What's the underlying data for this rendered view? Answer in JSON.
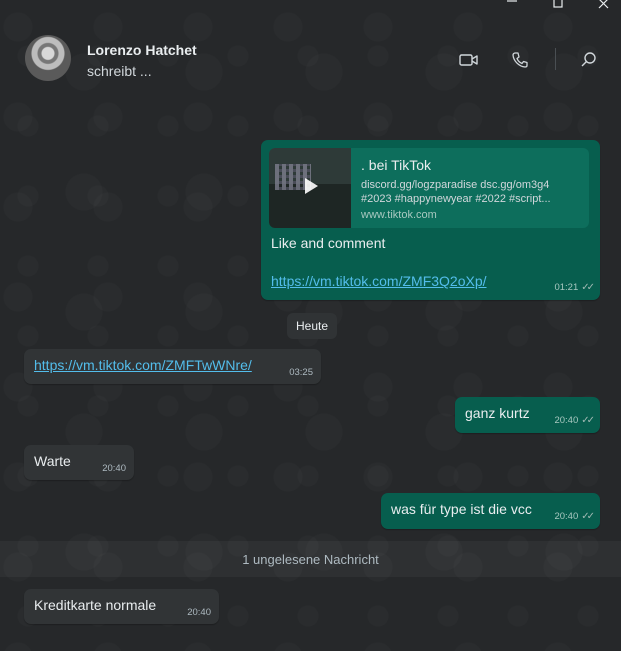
{
  "window": {
    "minimize": "—",
    "maximize": "▢",
    "close": "✕"
  },
  "contact": {
    "name": "Lorenzo Hatchet",
    "status": "schreibt ..."
  },
  "header_icons": [
    "video-call-icon",
    "voice-call-icon",
    "search-icon"
  ],
  "messages": {
    "tiktok_share": {
      "preview_title": ". bei TikTok",
      "preview_desc": "discord.gg/logzparadise dsc.gg/om3g4 #2023 #happynewyear #2022 #script...",
      "preview_url": "www.tiktok.com",
      "text": "Like and comment",
      "link": "https://vm.tiktok.com/ZMF3Q2oXp/",
      "time": "01:21"
    },
    "day_separator": "Heute",
    "incoming_link": {
      "link": "https://vm.tiktok.com/ZMFTwWNre/",
      "time": "03:25"
    },
    "ganz_kurtz": {
      "text": "ganz kurtz",
      "time": "20:40"
    },
    "warte": {
      "text": "Warte",
      "time": "20:40"
    },
    "vcc_question": {
      "text": "was für type ist die vcc",
      "time": "20:40"
    },
    "unread_banner": "1 ungelesene Nachricht",
    "kreditkarte": {
      "text": "Kreditkarte normale",
      "time": "20:40"
    }
  },
  "colors": {
    "outgoing": "#075e4e",
    "incoming": "#313436",
    "link": "#53bdeb",
    "background": "#232527"
  }
}
